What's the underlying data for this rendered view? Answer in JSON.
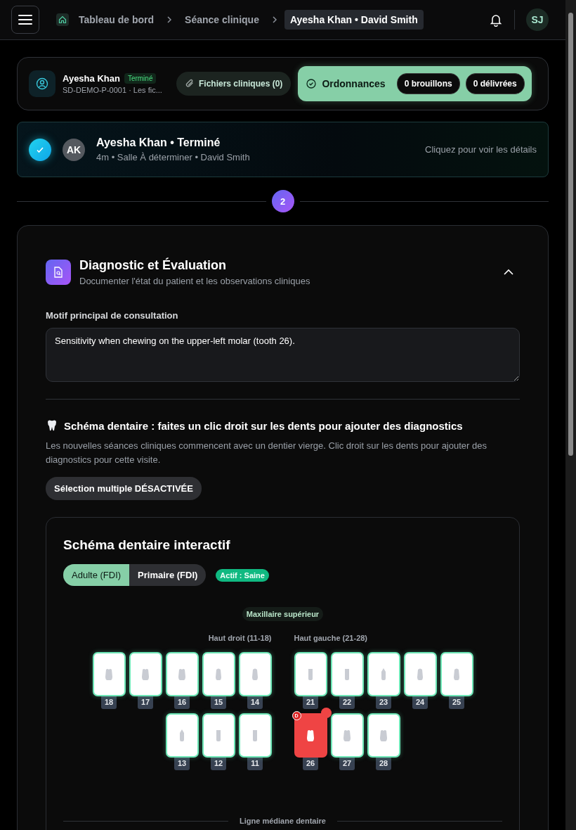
{
  "header": {
    "breadcrumbs": [
      {
        "label": "Tableau de bord",
        "selected": false,
        "kind": "home"
      },
      {
        "label": "Séance clinique",
        "selected": false,
        "kind": "plain"
      },
      {
        "label": "Ayesha Khan • David Smith",
        "selected": true,
        "kind": "plain"
      }
    ],
    "avatar": "SJ"
  },
  "patient_bar": {
    "name": "Ayesha Khan",
    "status": "Terminé",
    "id_line": "SD-DEMO-P-0001 · Les fic...",
    "files_button": "Fichiers cliniques (0)",
    "prescriptions": {
      "label": "Ordonnances",
      "counts": [
        "0 brouillons",
        "0 délivrées"
      ]
    }
  },
  "session_card": {
    "done": true,
    "initials": "AK",
    "title": "Ayesha Khan • Terminé",
    "meta": "4m • Salle À déterminer • David Smith",
    "hint": "Cliquez pour voir les détails"
  },
  "step": "2",
  "section": {
    "title": "Diagnostic et Évaluation",
    "subtitle": "Documenter l'état du patient et les observations cliniques",
    "expanded": true,
    "complaint": {
      "label": "Motif principal de consultation",
      "value": "Sensitivity when chewing on the upper-left molar (tooth 26)."
    },
    "chart_heading": "Schéma dentaire : faites un clic droit sur les dents pour ajouter des diagnostics",
    "chart_description": "Les nouvelles séances cliniques commencent avec un dentier vierge. Clic droit sur les dents pour ajouter des diagnostics pour cette visite.",
    "multi_select": {
      "label": "Sélection multiple DÉSACTIVÉE",
      "on": false
    },
    "dental_chart": {
      "title": "Schéma dentaire interactif",
      "dentitions": [
        {
          "label": "Adulte (FDI)",
          "selected": true
        },
        {
          "label": "Primaire (FDI)",
          "selected": false
        }
      ],
      "active_badge": "Actif : Saine",
      "arch": "Maxillaire supérieur",
      "quadrants": [
        {
          "label": "Haut droit (11-18)",
          "teeth": [
            {
              "number": "18",
              "kind": "molar",
              "diagnosed": false
            },
            {
              "number": "17",
              "kind": "molar",
              "diagnosed": false
            },
            {
              "number": "16",
              "kind": "molar",
              "diagnosed": false
            },
            {
              "number": "15",
              "kind": "premolar",
              "diagnosed": false
            },
            {
              "number": "14",
              "kind": "premolar",
              "diagnosed": false
            },
            {
              "number": "13",
              "kind": "canine",
              "diagnosed": false
            },
            {
              "number": "12",
              "kind": "incisor",
              "diagnosed": false
            },
            {
              "number": "11",
              "kind": "incisor",
              "diagnosed": false
            }
          ]
        },
        {
          "label": "Haut gauche (21-28)",
          "teeth": [
            {
              "number": "21",
              "kind": "incisor",
              "diagnosed": false
            },
            {
              "number": "22",
              "kind": "incisor",
              "diagnosed": false
            },
            {
              "number": "23",
              "kind": "canine",
              "diagnosed": false
            },
            {
              "number": "24",
              "kind": "premolar",
              "diagnosed": false
            },
            {
              "number": "25",
              "kind": "premolar",
              "diagnosed": false
            },
            {
              "number": "26",
              "kind": "molar",
              "diagnosed": true,
              "badge": "D"
            },
            {
              "number": "27",
              "kind": "molar",
              "diagnosed": false
            },
            {
              "number": "28",
              "kind": "molar",
              "diagnosed": false
            }
          ]
        }
      ],
      "midline": "Ligne médiane dentaire"
    }
  }
}
